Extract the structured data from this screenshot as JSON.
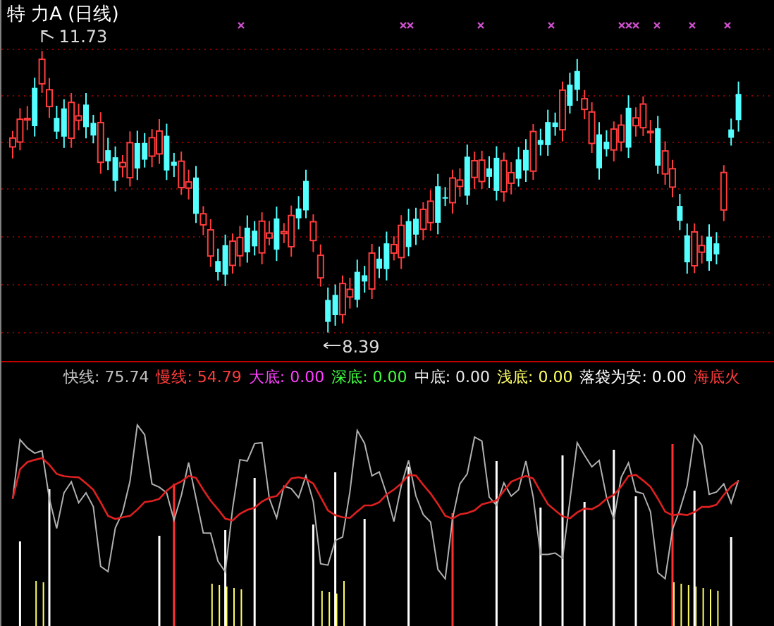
{
  "chart_title": "特 力A (日线)",
  "price_chart": {
    "high_label": "11.73",
    "low_label": "8.39"
  },
  "indicator_legend": [
    {
      "name": "快线:",
      "value": "75.74",
      "color": "#c0c0c0"
    },
    {
      "name": "慢线:",
      "value": "54.79",
      "color": "#ff3c3c"
    },
    {
      "name": "大底:",
      "value": "0.00",
      "color": "#ff40ff"
    },
    {
      "name": "深底:",
      "value": "0.00",
      "color": "#40ff40"
    },
    {
      "name": "中底:",
      "value": "0.00",
      "color": "#e8e8e8"
    },
    {
      "name": "浅底:",
      "value": "0.00",
      "color": "#ffff66"
    },
    {
      "name": "落袋为安:",
      "value": "0.00",
      "color": "#ffffff"
    },
    {
      "name": "海底火",
      "color": "#ff3c3c"
    }
  ]
}
